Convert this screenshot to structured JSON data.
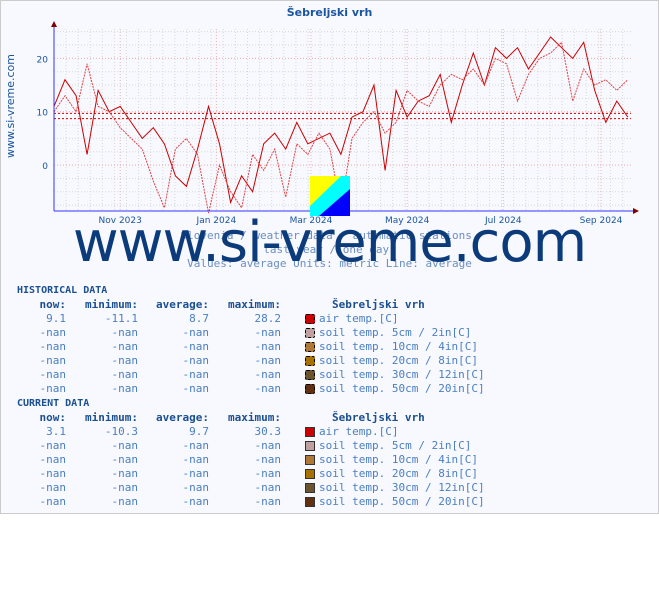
{
  "title": "Šebreljski vrh",
  "side_text": "www.si-vreme.com",
  "watermark": "www.si-vreme.com",
  "subtitle": [
    "Slovenia / weather data - automatic stations.",
    "last year / one day.",
    "Values: average  Units: metric  Line: average"
  ],
  "colors": {
    "line": "#cc0000",
    "axis": "#0000ff",
    "grid": "#e0a0a0",
    "title": "#1a56a0"
  },
  "chart_data": {
    "type": "line",
    "title": "Šebreljski vrh",
    "xlim": [
      "2023-09-20",
      "2024-09-20"
    ],
    "ylim": [
      -8.6,
      25.5
    ],
    "yticks": [
      0,
      10,
      20
    ],
    "xticks": [
      {
        "date": "2023-11-01",
        "label": "Nov 2023"
      },
      {
        "date": "2024-01-01",
        "label": "Jan 2024"
      },
      {
        "date": "2024-03-01",
        "label": "Mar 2024"
      },
      {
        "date": "2024-05-01",
        "label": "May 2024"
      },
      {
        "date": "2024-07-01",
        "label": "Jul 2024"
      },
      {
        "date": "2024-09-01",
        "label": "Sep 2024"
      }
    ],
    "grid": true,
    "x": [
      "2023-09-20",
      "2023-09-27",
      "2023-10-04",
      "2023-10-11",
      "2023-10-18",
      "2023-10-25",
      "2023-11-01",
      "2023-11-08",
      "2023-11-15",
      "2023-11-22",
      "2023-11-29",
      "2023-12-06",
      "2023-12-13",
      "2023-12-20",
      "2023-12-27",
      "2024-01-03",
      "2024-01-10",
      "2024-01-17",
      "2024-01-24",
      "2024-01-31",
      "2024-02-07",
      "2024-02-14",
      "2024-02-21",
      "2024-02-28",
      "2024-03-06",
      "2024-03-13",
      "2024-03-20",
      "2024-03-27",
      "2024-04-03",
      "2024-04-10",
      "2024-04-17",
      "2024-04-24",
      "2024-05-01",
      "2024-05-08",
      "2024-05-15",
      "2024-05-22",
      "2024-05-29",
      "2024-06-05",
      "2024-06-12",
      "2024-06-19",
      "2024-06-26",
      "2024-07-03",
      "2024-07-10",
      "2024-07-17",
      "2024-07-24",
      "2024-07-31",
      "2024-08-07",
      "2024-08-14",
      "2024-08-21",
      "2024-08-28",
      "2024-09-04",
      "2024-09-11",
      "2024-09-18"
    ],
    "series": [
      {
        "style": "solid",
        "color": "#cc0000",
        "values": [
          11,
          16,
          13,
          2,
          14,
          10,
          11,
          8,
          5,
          7,
          4,
          -2,
          -4,
          3,
          11,
          4,
          -7,
          -2,
          -5,
          4,
          6,
          3,
          8,
          4,
          5,
          6,
          2,
          9,
          10,
          15,
          -1,
          14,
          9,
          12,
          13,
          17,
          8,
          15,
          21,
          15,
          22,
          20,
          22,
          18,
          21,
          24,
          22,
          20,
          23,
          14,
          8,
          12,
          9
        ]
      },
      {
        "style": "dashed",
        "color": "#dd4444",
        "values": [
          10,
          13,
          10,
          19,
          11,
          10,
          7,
          5,
          3,
          -3,
          -8,
          3,
          5,
          2,
          -9,
          0,
          -5,
          -8,
          2,
          -1,
          3,
          -6,
          4,
          2,
          6,
          3,
          -8,
          5,
          8,
          10,
          6,
          8,
          14,
          12,
          11,
          15,
          17,
          16,
          18,
          15,
          20,
          19,
          12,
          17,
          20,
          21,
          23,
          12,
          18,
          15,
          16,
          14,
          16
        ]
      }
    ],
    "hlines": [
      {
        "value": 9.7,
        "style": "dotted"
      },
      {
        "value": 8.7,
        "style": "dotted"
      }
    ]
  },
  "historical": {
    "label": "HISTORICAL DATA",
    "headers": [
      "now:",
      "minimum:",
      "average:",
      "maximum:",
      "Šebreljski vrh"
    ],
    "rows": [
      {
        "now": "9.1",
        "min": "-11.1",
        "avg": "8.7",
        "max": "28.2",
        "color": "#cc0000",
        "label": "air temp.[C]"
      },
      {
        "now": "-nan",
        "min": "-nan",
        "avg": "-nan",
        "max": "-nan",
        "color": "#c0a0a0",
        "label": "soil temp. 5cm / 2in[C]"
      },
      {
        "now": "-nan",
        "min": "-nan",
        "avg": "-nan",
        "max": "-nan",
        "color": "#b07838",
        "label": "soil temp. 10cm / 4in[C]"
      },
      {
        "now": "-nan",
        "min": "-nan",
        "avg": "-nan",
        "max": "-nan",
        "color": "#a87000",
        "label": "soil temp. 20cm / 8in[C]"
      },
      {
        "now": "-nan",
        "min": "-nan",
        "avg": "-nan",
        "max": "-nan",
        "color": "#6a5530",
        "label": "soil temp. 30cm / 12in[C]"
      },
      {
        "now": "-nan",
        "min": "-nan",
        "avg": "-nan",
        "max": "-nan",
        "color": "#603010",
        "label": "soil temp. 50cm / 20in[C]"
      }
    ]
  },
  "current": {
    "label": "CURRENT DATA",
    "headers": [
      "now:",
      "minimum:",
      "average:",
      "maximum:",
      "Šebreljski vrh"
    ],
    "rows": [
      {
        "now": "3.1",
        "min": "-10.3",
        "avg": "9.7",
        "max": "30.3",
        "color": "#cc0000",
        "label": "air temp.[C]"
      },
      {
        "now": "-nan",
        "min": "-nan",
        "avg": "-nan",
        "max": "-nan",
        "color": "#c0a0a0",
        "label": "soil temp. 5cm / 2in[C]"
      },
      {
        "now": "-nan",
        "min": "-nan",
        "avg": "-nan",
        "max": "-nan",
        "color": "#b07838",
        "label": "soil temp. 10cm / 4in[C]"
      },
      {
        "now": "-nan",
        "min": "-nan",
        "avg": "-nan",
        "max": "-nan",
        "color": "#a87000",
        "label": "soil temp. 20cm / 8in[C]"
      },
      {
        "now": "-nan",
        "min": "-nan",
        "avg": "-nan",
        "max": "-nan",
        "color": "#6a5530",
        "label": "soil temp. 30cm / 12in[C]"
      },
      {
        "now": "-nan",
        "min": "-nan",
        "avg": "-nan",
        "max": "-nan",
        "color": "#603010",
        "label": "soil temp. 50cm / 20in[C]"
      }
    ]
  }
}
